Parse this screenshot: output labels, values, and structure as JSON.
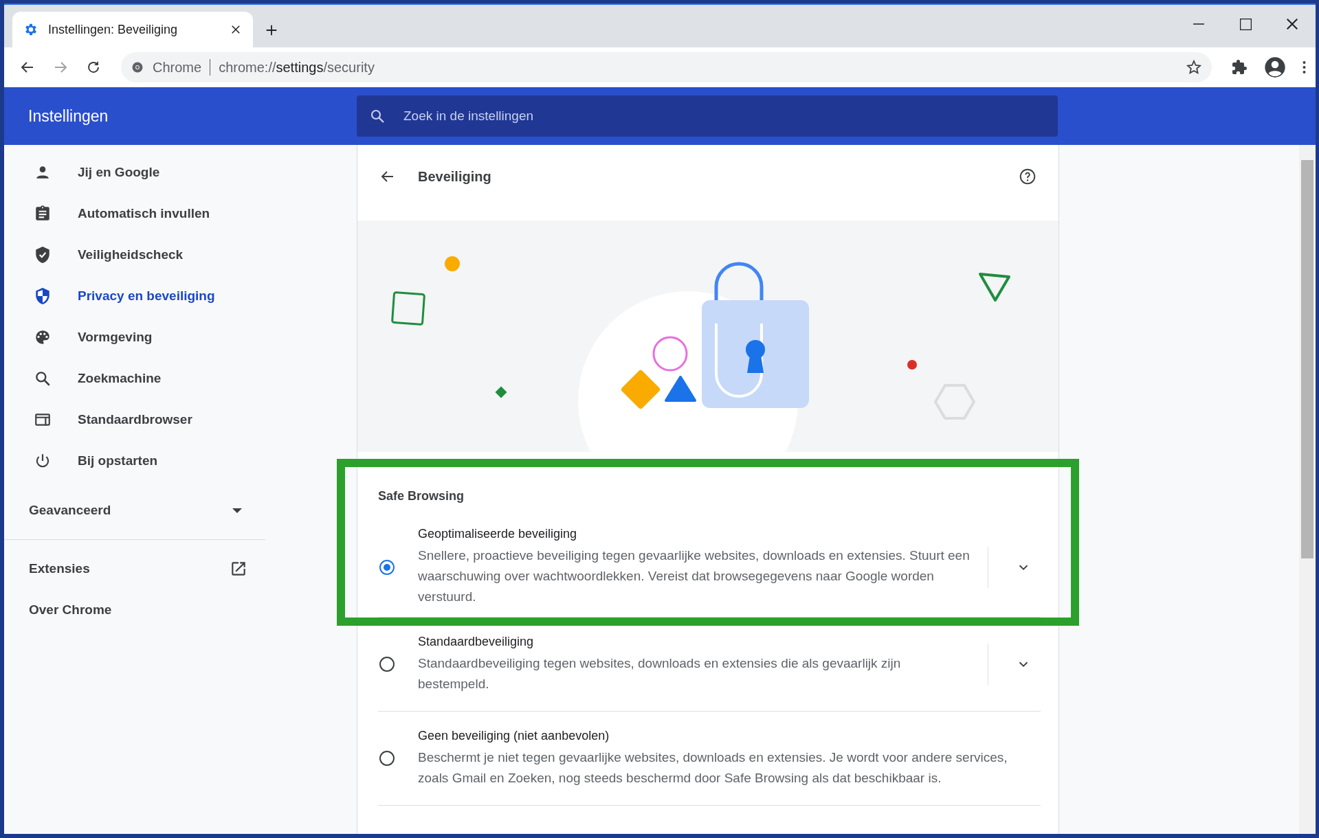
{
  "tabs": [
    {
      "title": "Instellingen: Beveiliging",
      "selected": true
    }
  ],
  "address_bar": {
    "site_label": "Chrome",
    "url": "chrome://**settings**/security"
  },
  "header": {
    "title": "Instellingen",
    "search_placeholder": "Zoek in de instellingen"
  },
  "sidebar": {
    "items": [
      {
        "label": "Jij en Google",
        "selected": false
      },
      {
        "label": "Automatisch invullen",
        "selected": false
      },
      {
        "label": "Veiligheidscheck",
        "selected": false
      },
      {
        "label": "Privacy en beveiliging",
        "selected": true
      },
      {
        "label": "Vormgeving",
        "selected": false
      },
      {
        "label": "Zoekmachine",
        "selected": false
      },
      {
        "label": "Standaardbrowser",
        "selected": false
      },
      {
        "label": "Bij opstarten",
        "selected": false
      }
    ],
    "advanced": {
      "label": "Geavanceerd",
      "expanded": false
    },
    "links": [
      {
        "label": "Extensies",
        "kind": "external"
      },
      {
        "label": "Over Chrome",
        "kind": "internal"
      }
    ]
  },
  "page": {
    "title": "Beveiliging",
    "section": "Safe Browsing",
    "options": [
      {
        "title": "Geoptimaliseerde beveiliging",
        "description": "Snellere, proactieve beveiliging tegen gevaarlijke websites, downloads en extensies. Stuurt een waarschuwing over wachtwoordlekken. Vereist dat browsegegevens naar Google worden verstuurd.",
        "selected": true,
        "expandable": true,
        "highlighted": true
      },
      {
        "title": "Standaardbeveiliging",
        "description": "Standaardbeveiliging tegen websites, downloads en extensies die als gevaarlijk zijn bestempeld.",
        "selected": false,
        "expandable": true,
        "highlighted": false
      },
      {
        "title": "Geen beveiliging (niet aanbevolen)",
        "description": "Beschermt je niet tegen gevaarlijke websites, downloads en extensies. Je wordt voor andere services, zoals Gmail en Zoeken, nog steeds beschermd door Safe Browsing als dat beschikbaar is.",
        "selected": false,
        "expandable": false,
        "highlighted": false
      }
    ]
  }
}
